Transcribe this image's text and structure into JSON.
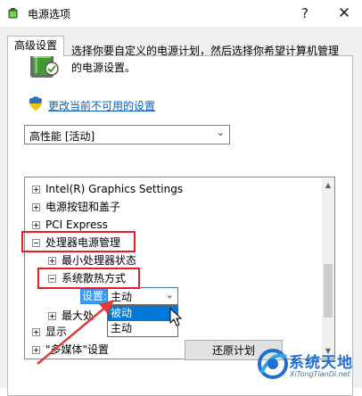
{
  "window": {
    "title": "电源选项",
    "help_glyph": "?",
    "close_glyph": "✕"
  },
  "tab": {
    "label": "高级设置"
  },
  "description": "选择你要自定义的电源计划，然后选择你希望计算机管理的电源设置。",
  "change_link": "更改当前不可用的设置",
  "plan_select": {
    "value": "高性能 [活动]"
  },
  "tree": {
    "items": [
      {
        "label": "Intel(R) Graphics Settings",
        "expanded": false
      },
      {
        "label": "电源按钮和盖子",
        "expanded": false
      },
      {
        "label": "PCI Express",
        "expanded": false
      },
      {
        "label": "处理器电源管理",
        "expanded": true
      },
      {
        "label": "最小处理器状态",
        "expanded": false
      },
      {
        "label": "系统散热方式",
        "expanded": true
      },
      {
        "label": "最大处",
        "expanded": false
      },
      {
        "label": "显示",
        "expanded": false
      },
      {
        "label": "\"多媒体\"设置",
        "expanded": false
      }
    ],
    "setting": {
      "label": "设置:",
      "value": "主动",
      "options": [
        "被动",
        "主动"
      ],
      "highlighted_option": "被动"
    }
  },
  "restore_button": "还原计划",
  "watermark": {
    "main": "系统天地",
    "sub": "XiTongTianDi.net"
  },
  "colors": {
    "highlight_box": "#e81c24",
    "link": "#0a5fb4",
    "selection": "#0078d7",
    "setting_label_bg": "#3399ff",
    "watermark_blue": "#1f6fd0"
  }
}
